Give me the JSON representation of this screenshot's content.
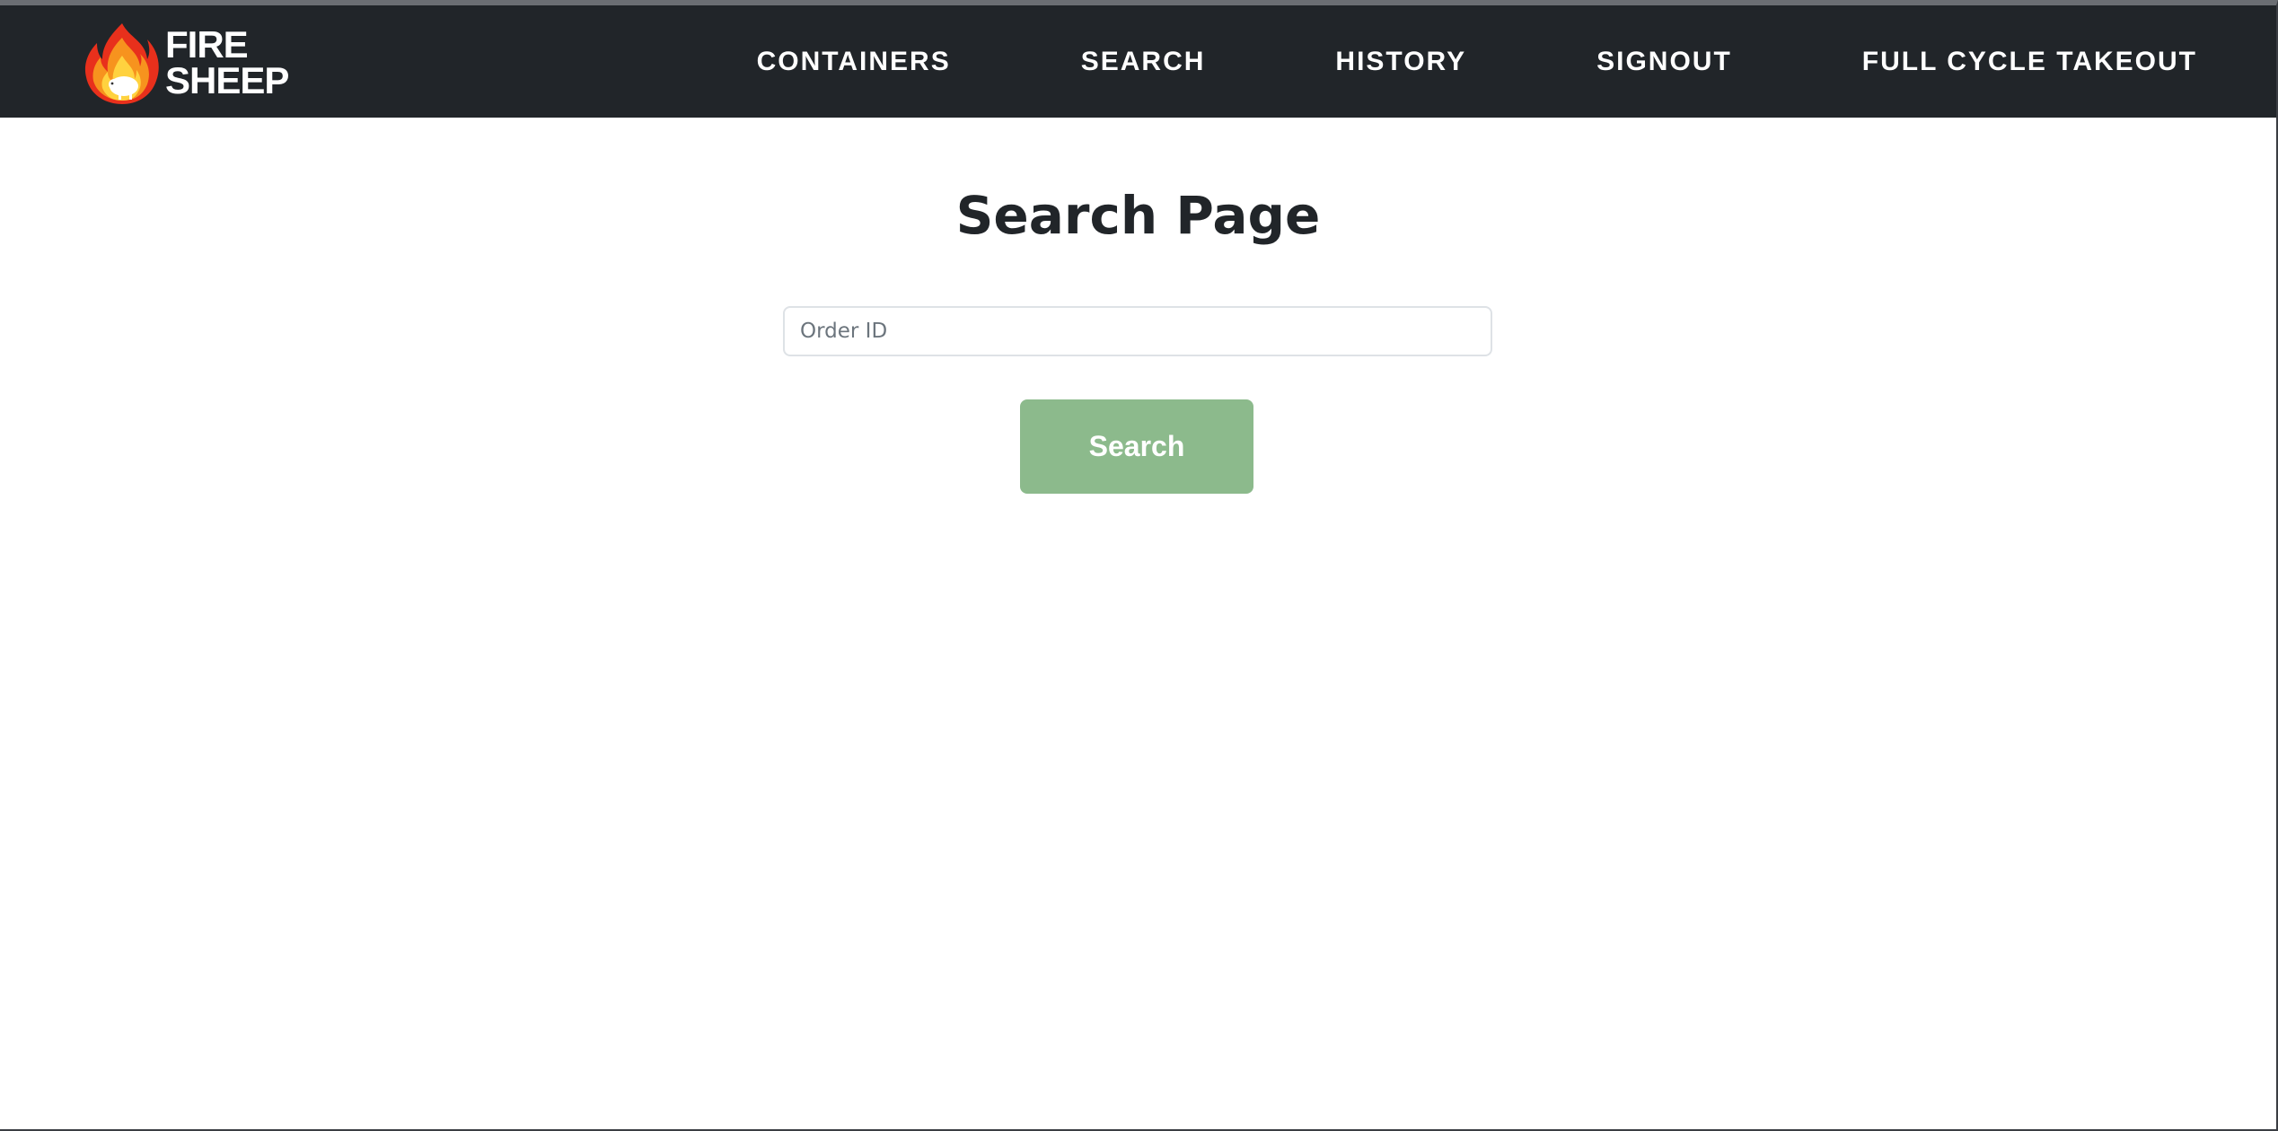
{
  "brand": {
    "line1": "FIRE",
    "line2": "SHEEP",
    "logo_icon": "flaming-sheep-icon"
  },
  "nav": {
    "items": [
      {
        "label": "CONTAINERS"
      },
      {
        "label": "SEARCH"
      },
      {
        "label": "HISTORY"
      },
      {
        "label": "SIGNOUT"
      },
      {
        "label": "FULL CYCLE TAKEOUT"
      }
    ]
  },
  "main": {
    "title": "Search Page",
    "search_input": {
      "value": "",
      "placeholder": "Order ID"
    },
    "search_button_label": "Search"
  },
  "colors": {
    "navbar_bg": "#212529",
    "button_bg": "#8cba8c",
    "title_text": "#212529"
  }
}
